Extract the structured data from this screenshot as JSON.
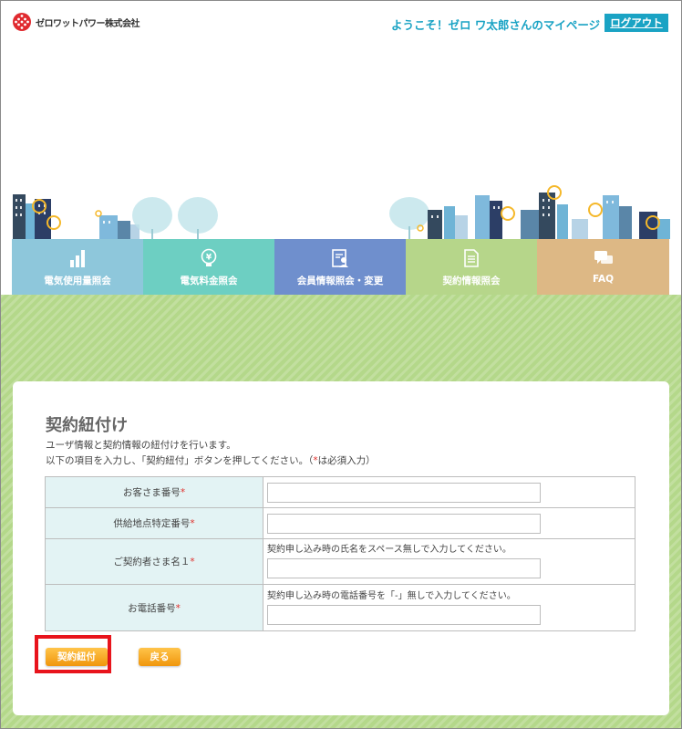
{
  "header": {
    "company_name": "ゼロワットパワー株式会社",
    "welcome_text": "ようこそ！ゼロ ワ太郎さんのマイページ",
    "logout_label": "ログアウト"
  },
  "nav": {
    "tabs": [
      {
        "label": "電気使用量照会",
        "icon": "bar-chart-icon"
      },
      {
        "label": "電気料金照会",
        "icon": "lightbulb-yen-icon"
      },
      {
        "label": "会員情報照会・変更",
        "icon": "member-card-icon"
      },
      {
        "label": "契約情報照会",
        "icon": "document-icon"
      },
      {
        "label": "FAQ",
        "icon": "speech-bubbles-icon"
      }
    ]
  },
  "form": {
    "title": "契約紐付け",
    "description_1": "ユーザ情報と契約情報の紐付けを行います。",
    "description_2a": "以下の項目を入力し、「契約紐付」ボタンを押してください。（",
    "description_2_required_mark": "*",
    "description_2b": "は必須入力）",
    "required_mark": "*",
    "fields": [
      {
        "label": "お客さま番号",
        "hint": "",
        "value": ""
      },
      {
        "label": "供給地点特定番号",
        "hint": "",
        "value": ""
      },
      {
        "label": "ご契約者さま名１",
        "hint": "契約申し込み時の氏名をスペース無しで入力してください。",
        "value": ""
      },
      {
        "label": "お電話番号",
        "hint": "契約申し込み時の電話番号を「-」無しで入力してください。",
        "value": ""
      }
    ],
    "submit_label": "契約紐付",
    "back_label": "戻る"
  },
  "colors": {
    "accent": "#1aa3c4",
    "band": "#b4d88a",
    "button": "#f0a21a",
    "highlight": "#e8141c",
    "required": "#e0302c"
  }
}
